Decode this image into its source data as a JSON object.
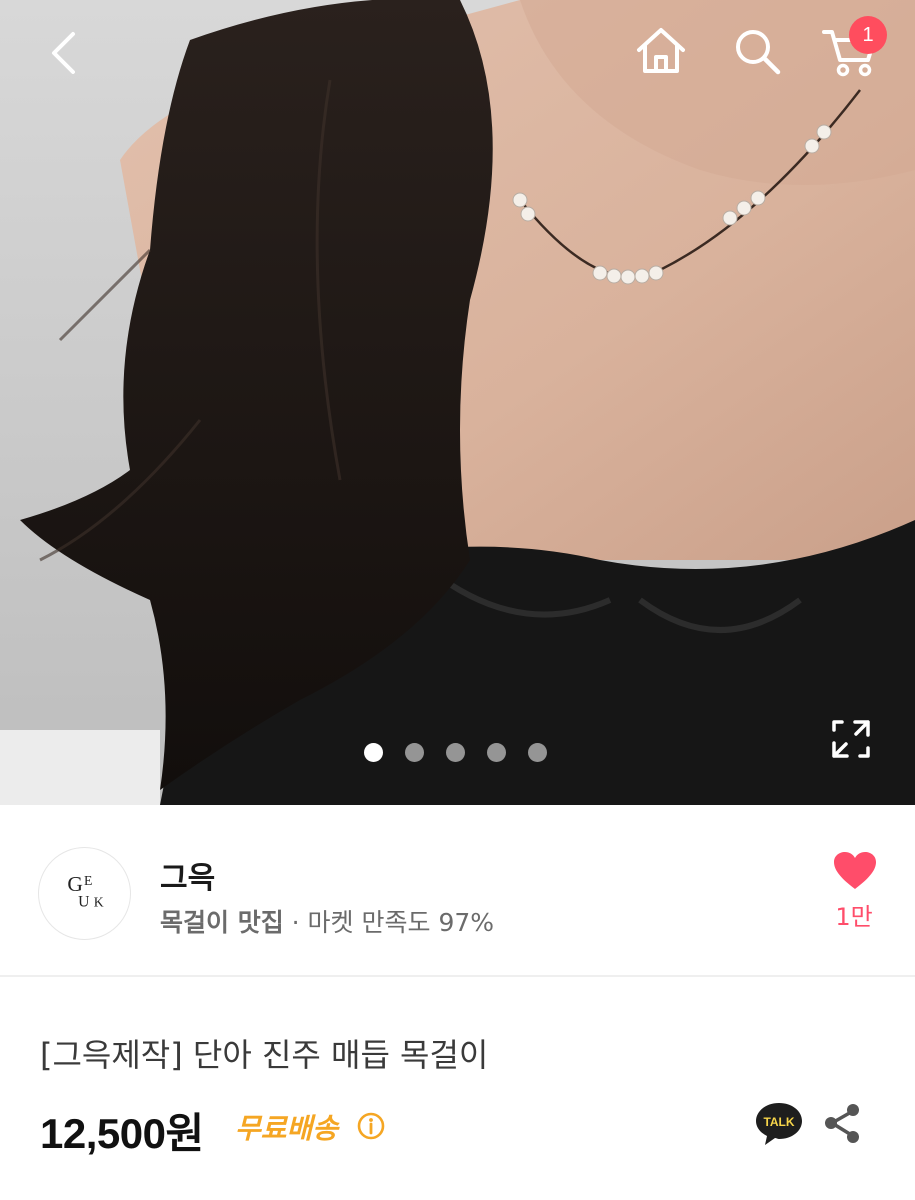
{
  "header": {
    "icons": [
      "back-icon",
      "home-icon",
      "search-icon",
      "cart-icon"
    ],
    "cart_count": "1"
  },
  "gallery": {
    "total_images": 5,
    "active_index": 0,
    "expand_icon": "expand-icon"
  },
  "seller": {
    "logo_text": "GEUK",
    "name": "그윽",
    "tag": "목걸이 맛집",
    "satisfaction": " · 마켓 만족도 97%",
    "like_icon": "heart-icon",
    "likes": "1만",
    "heart_color": "#ff4d6a"
  },
  "product": {
    "title": "[그윽제작] 단아 진주 매듭 목걸이",
    "price": "12,500원",
    "shipping": "무료배송",
    "shipping_color": "#f5a623",
    "info_icon": "info-icon",
    "talk_label": "TALK",
    "share_icon": "share-icon"
  }
}
